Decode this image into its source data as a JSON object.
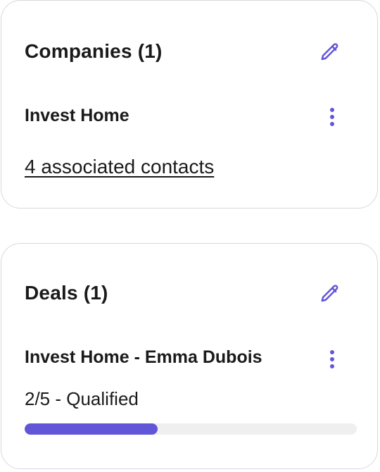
{
  "colors": {
    "accent": "#6256d8",
    "border": "#d9d9dd",
    "progress_track": "#efefef",
    "text": "#1a1a1a"
  },
  "companies": {
    "title": "Companies (1)",
    "edit_icon": "pencil-icon",
    "item": {
      "name": "Invest Home",
      "more_icon": "vertical-dots-icon",
      "contacts_link": "4 associated contacts"
    }
  },
  "deals": {
    "title": "Deals (1)",
    "edit_icon": "pencil-icon",
    "item": {
      "name": "Invest Home - Emma Dubois",
      "more_icon": "vertical-dots-icon",
      "stage": "2/5 - Qualified",
      "progress": 0.4
    }
  }
}
